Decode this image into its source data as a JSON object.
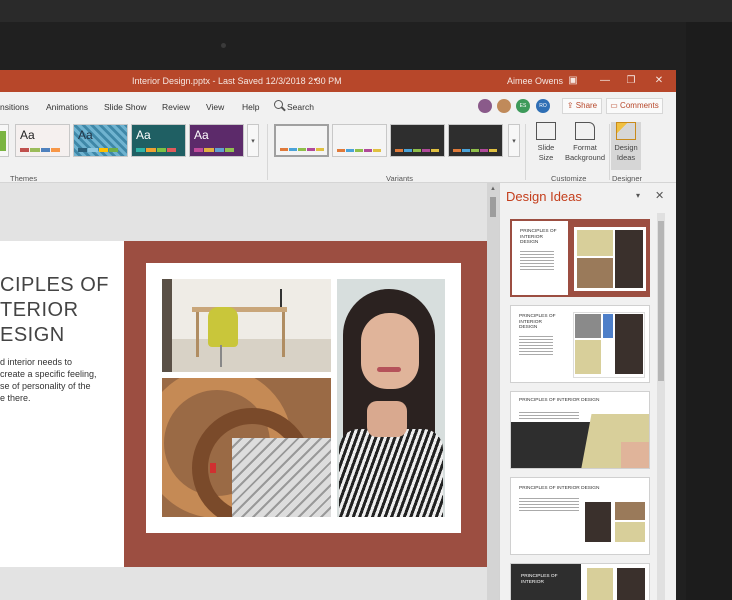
{
  "window": {
    "title": "Interior Design.pptx  -  Last Saved  12/3/2018  2:30 PM",
    "user": "Aimee Owens"
  },
  "menu": {
    "items": [
      "nsitions",
      "Animations",
      "Slide Show",
      "Review",
      "View",
      "Help"
    ],
    "search_label": "Search",
    "share_label": "Share",
    "comments_label": "Comments",
    "avatars": [
      "",
      "",
      "ES",
      "RO"
    ]
  },
  "ribbon": {
    "themes_label": "Themes",
    "variants_label": "Variants",
    "customize_label": "Customize",
    "designer_label": "Designer",
    "theme_tiles": [
      "Aa",
      "Aa",
      "Aa",
      "Aa"
    ],
    "slide_size_label": "Slide\nSize",
    "format_background_label": "Format\nBackground",
    "design_ideas_label": "Design\nIdeas"
  },
  "slide": {
    "title": "CIPLES OF\nTERIOR\nESIGN",
    "body": "d interior needs to\ncreate a specific feeling,\nse of personality of the\ne there."
  },
  "pane": {
    "title": "Design Ideas",
    "ideas": [
      {
        "heading": "PRINCIPLES OF\nINTERIOR\nDESIGN"
      },
      {
        "heading": "PRINCIPLES OF\nINTERIOR\nDESIGN"
      },
      {
        "heading": "PRINCIPLES OF INTERIOR DESIGN"
      },
      {
        "heading": "PRINCIPLES OF INTERIOR DESIGN"
      },
      {
        "heading": "PRINCIPLES OF\nINTERIOR"
      }
    ]
  },
  "colors": {
    "accent": "#b7472a",
    "brick": "#9c4e41"
  }
}
